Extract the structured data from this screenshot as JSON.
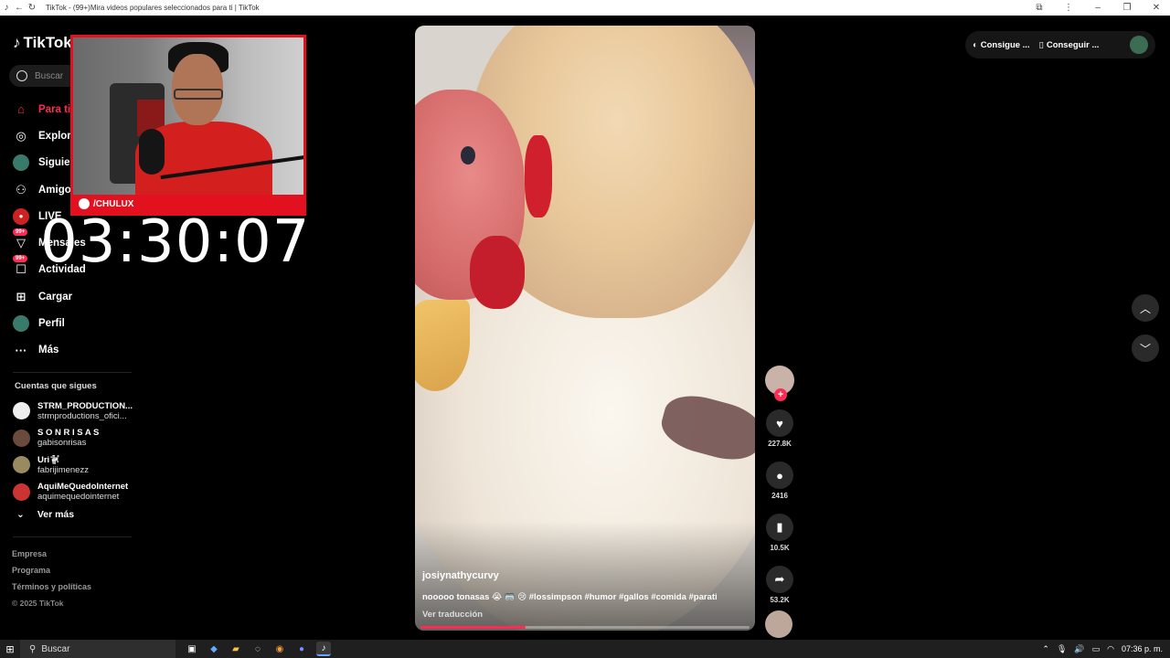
{
  "browser": {
    "title": "TikTok - (99+)Mira videos populares seleccionados para ti | TikTok",
    "back_icon": "←",
    "refresh_icon": "↻"
  },
  "sidebar": {
    "logo": "TikTok",
    "search_placeholder": "Buscar",
    "nav": [
      {
        "label": "Para ti",
        "icon": "home-icon"
      },
      {
        "label": "Explorar",
        "icon": "compass-icon"
      },
      {
        "label": "Siguiendo",
        "icon": "following-avatar-icon"
      },
      {
        "label": "Amigos",
        "icon": "friends-icon"
      },
      {
        "label": "LIVE",
        "icon": "live-icon"
      },
      {
        "label": "Mensajes",
        "icon": "messages-icon",
        "badge": "99+"
      },
      {
        "label": "Actividad",
        "icon": "activity-icon",
        "badge": "99+"
      },
      {
        "label": "Cargar",
        "icon": "upload-icon"
      },
      {
        "label": "Perfil",
        "icon": "profile-avatar-icon"
      },
      {
        "label": "Más",
        "icon": "more-icon"
      }
    ],
    "following_title": "Cuentas que sigues",
    "following": [
      {
        "name": "STRM_PRODUCTION...",
        "handle": "strmproductions_ofici..."
      },
      {
        "name": "S O N R I S A S",
        "handle": "gabisonrisas"
      },
      {
        "name": "Uri🐩",
        "handle": "fabrijimenezz"
      },
      {
        "name": "AquiMeQuedoInternet",
        "handle": "aquimequedointernet"
      }
    ],
    "see_more": "Ver más",
    "footer": [
      "Empresa",
      "Programa",
      "Términos y políticas",
      "© 2025 TikTok"
    ]
  },
  "stream": {
    "nameplate": "/CHULUX",
    "timer": "03:30:07"
  },
  "video": {
    "author": "josiynathycurvy",
    "caption": "nooooo tonasas 😭 🥽 😢  #lossimpson #humor #gallos #comida #parati",
    "translate": "Ver traducción",
    "progress_percent": 32
  },
  "actions": {
    "likes": "227.8K",
    "comments": "2416",
    "saves": "10.5K",
    "shares": "53.2K",
    "follow_plus": "+"
  },
  "top_right": {
    "btn1": "Consigue ...",
    "btn2": "Conseguir ..."
  },
  "taskbar": {
    "search_label": "Buscar",
    "time": "07:36 p. m."
  }
}
